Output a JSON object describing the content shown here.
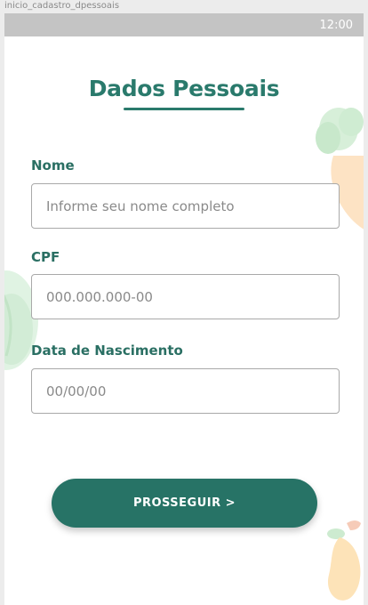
{
  "artboard": {
    "label": "inicio_cadastro_dpessoais"
  },
  "status_bar": {
    "time": "12:00"
  },
  "header": {
    "title": "Dados Pessoais"
  },
  "form": {
    "name": {
      "label": "Nome",
      "placeholder": "Informe seu nome completo",
      "value": ""
    },
    "cpf": {
      "label": "CPF",
      "placeholder": "000.000.000-00",
      "value": ""
    },
    "birthdate": {
      "label": "Data de Nascimento",
      "placeholder": "00/00/00",
      "value": ""
    }
  },
  "actions": {
    "continue_label": "PROSSEGUIR >"
  },
  "decorations": [
    "carrot-illustration",
    "cabbage-illustration",
    "mango-illustration"
  ],
  "colors": {
    "primary": "#277366",
    "title": "#2a7a6c",
    "label": "#2a6f63",
    "status_bar": "#c4c4c4",
    "input_border": "#a9a9a9"
  }
}
